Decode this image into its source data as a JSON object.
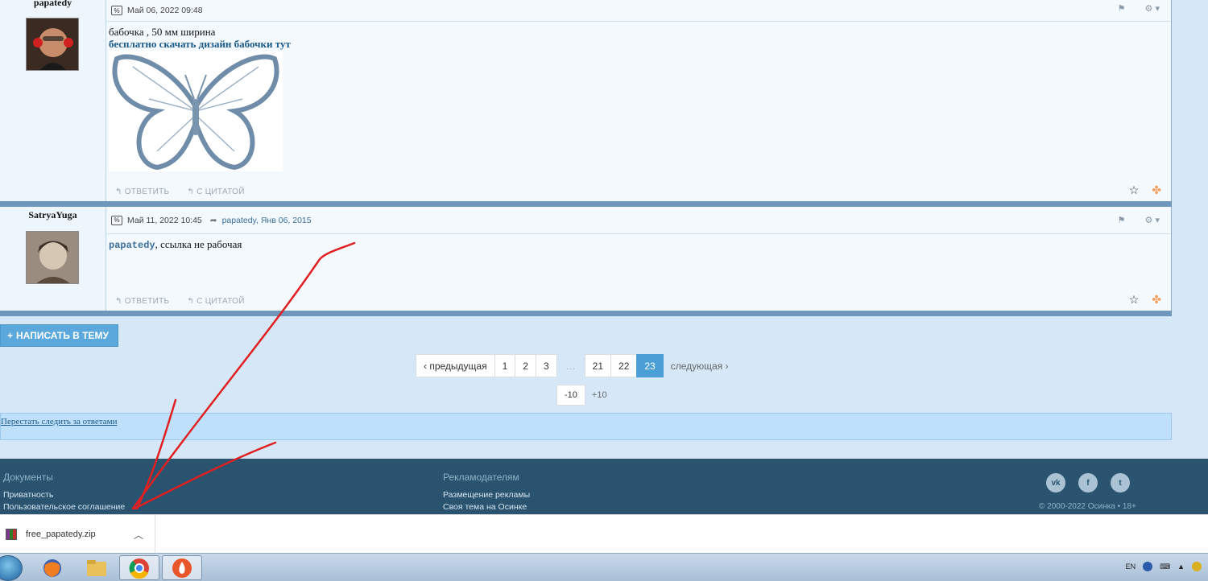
{
  "posts": [
    {
      "author": "papatedy",
      "date": "Май 06, 2022 09:48",
      "reply_to": "",
      "text": "бабочка , 50 мм ширина",
      "link_text": "бесплатно скачать дизайн бабочки тут",
      "actions": {
        "reply": "ОТВЕТИТЬ",
        "quote": "С ЦИТАТОЙ"
      }
    },
    {
      "author": "SatryaYuga",
      "date": "Май 11, 2022 10:45",
      "reply_to": "papatedy, Янв 06, 2015",
      "mention": "papatedy",
      "text": ", ссылка не рабочая",
      "actions": {
        "reply": "ОТВЕТИТЬ",
        "quote": "С ЦИТАТОЙ"
      }
    }
  ],
  "write_button": "НАПИСАТЬ В ТЕМУ",
  "pagination": {
    "prev": "‹ предыдущая",
    "pages": [
      "1",
      "2",
      "3"
    ],
    "ellipsis": "…",
    "pages_end": [
      "21",
      "22",
      "23"
    ],
    "current": "23",
    "next": "следующая ›",
    "minus10": "-10",
    "plus10": "+10"
  },
  "watch_link": "Перестать следить за ответами",
  "footer": {
    "col1": {
      "title": "Документы",
      "links": [
        "Приватность",
        "Пользовательское соглашение"
      ]
    },
    "col2": {
      "title": "Рекламодателям",
      "links": [
        "Размещение рекламы",
        "Своя тема на Осинке"
      ]
    },
    "copyright": "© 2000-2022 Осинка • 18+",
    "social": [
      "vk-icon",
      "facebook-icon",
      "twitter-icon"
    ]
  },
  "download": {
    "filename": "free_papatedy.zip"
  },
  "tray": {
    "lang": "EN"
  },
  "colors": {
    "accent": "#5aa8dc",
    "footer_bg": "#2a536f",
    "annotation": "#e02020"
  }
}
